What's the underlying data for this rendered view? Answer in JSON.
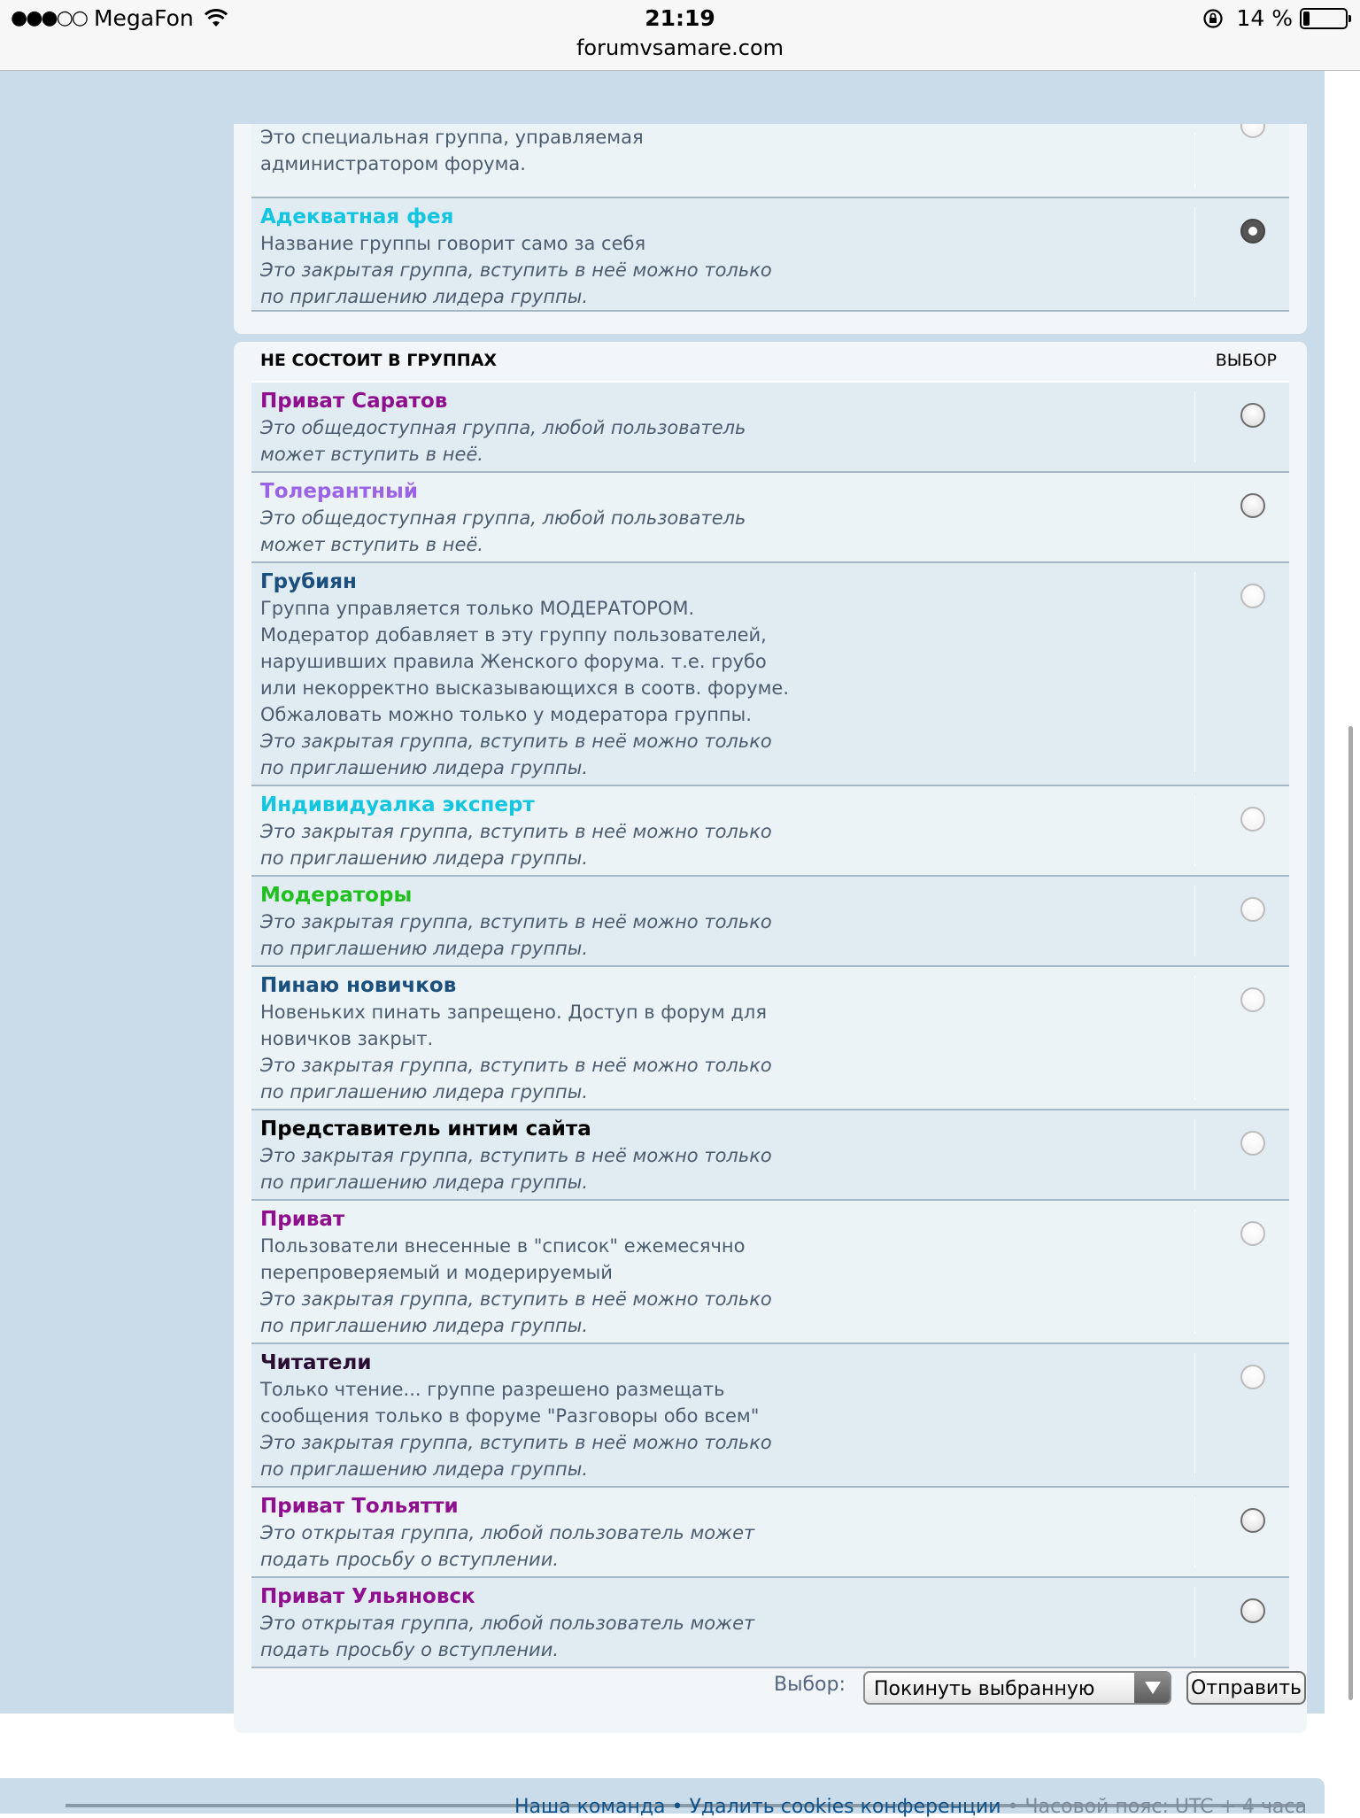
{
  "status_bar": {
    "carrier_signal": "●●●○○",
    "carrier": "MegaFon",
    "time": "21:19",
    "battery_percent": "14 %",
    "battery_level": 0.14,
    "url": "forumvsamare.com"
  },
  "member_groups": [
    {
      "name": "",
      "color": "#000000",
      "description": "Это специальная группа, управляемая администратором форума.",
      "note": "",
      "selected": false
    },
    {
      "name": "Адекватная фея",
      "color": "#12c5e0",
      "description": "Название группы говорит само за себя",
      "note": "Это закрытая группа, вступить в неё можно только по приглашению лидера группы.",
      "selected": true
    }
  ],
  "non_member": {
    "header_left": "НЕ СОСТОИТ В ГРУППАХ",
    "header_right": "ВЫБОР",
    "groups": [
      {
        "name": "Приват Саратов",
        "color": "#8f0f8f",
        "description": "",
        "note": "Это общедоступная группа, любой пользователь может вступить в неё.",
        "enabled": true
      },
      {
        "name": "Толерантный",
        "color": "#9b63e6",
        "description": "",
        "note": "Это общедоступная группа, любой пользователь может вступить в неё.",
        "enabled": true
      },
      {
        "name": "Грубиян",
        "color": "#1a4f7e",
        "description": "Группа управляется только МОДЕРАТОРОМ. Модератор добавляет в эту группу пользователей, нарушивших правила Женского форума. т.е. грубо или некорректно высказывающихся в соотв. форуме. Обжаловать можно только у модератора группы.",
        "note": "Это закрытая группа, вступить в неё можно только по приглашению лидера группы.",
        "enabled": false
      },
      {
        "name": "Индивидуалка эксперт",
        "color": "#12c5e0",
        "description": "",
        "note": "Это закрытая группа, вступить в неё можно только по приглашению лидера группы.",
        "enabled": false
      },
      {
        "name": "Модераторы",
        "color": "#1fc01f",
        "description": "",
        "note": "Это закрытая группа, вступить в неё можно только по приглашению лидера группы.",
        "enabled": false
      },
      {
        "name": "Пинаю новичков",
        "color": "#1a4f7e",
        "description": "Новеньких пинать запрещено. Доступ в форум для новичков закрыт.",
        "note": "Это закрытая группа, вступить в неё можно только по приглашению лидера группы.",
        "enabled": false
      },
      {
        "name": "Представитель интим сайта",
        "color": "#000000",
        "description": "",
        "note": "Это закрытая группа, вступить в неё можно только по приглашению лидера группы.",
        "enabled": false
      },
      {
        "name": "Приват",
        "color": "#8f0f8f",
        "description": "Пользователи внесенные в \"список\" ежемесячно перепроверяемый и модерируемый",
        "note": "Это закрытая группа, вступить в неё можно только по приглашению лидера группы.",
        "enabled": false
      },
      {
        "name": "Читатели",
        "color": "#2a0d33",
        "description": "Только чтение... группе разрешено размещать сообщения только в форуме \"Разговоры обо всем\"",
        "note": "Это закрытая группа, вступить в неё можно только по приглашению лидера группы.",
        "enabled": false
      },
      {
        "name": "Приват Тольятти",
        "color": "#8f0f8f",
        "description": "",
        "note": "Это открытая группа, любой пользователь может подать просьбу о вступлении.",
        "enabled": true
      },
      {
        "name": "Приват Ульяновск",
        "color": "#8f0f8f",
        "description": "",
        "note": "Это открытая группа, любой пользователь может подать просьбу о вступлении.",
        "enabled": true
      }
    ]
  },
  "action_bar": {
    "label": "Выбор:",
    "selected_option": "Покинуть выбранную",
    "submit_label": "Отправить"
  },
  "footer": {
    "team_link": "Наша команда",
    "sep1": " • ",
    "cookies_link": "Удалить cookies конференции",
    "sep2": " • ",
    "timezone": "Часовой пояс: UTC + 4 часа"
  }
}
